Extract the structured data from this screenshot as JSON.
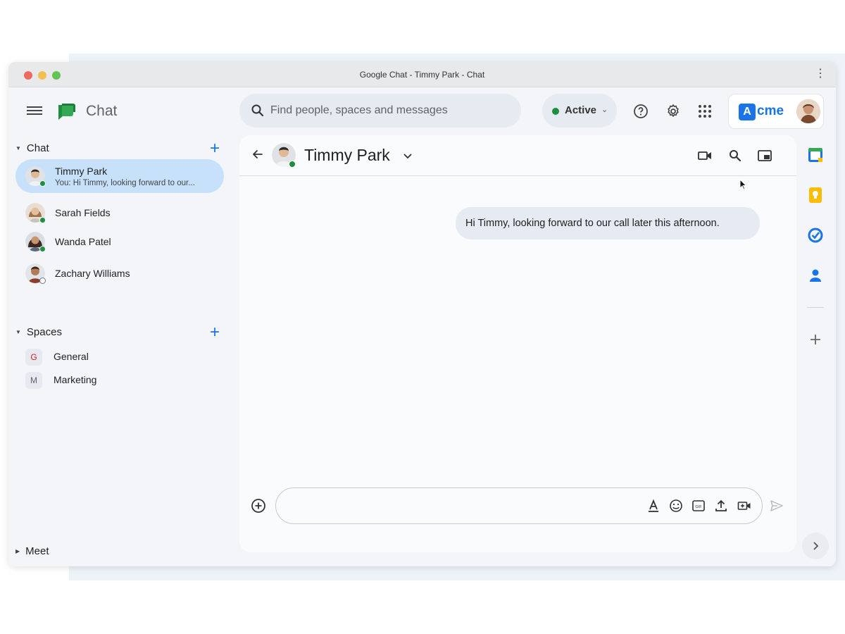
{
  "window": {
    "title": "Google Chat - Timmy Park - Chat"
  },
  "header": {
    "app_name": "Chat",
    "search_placeholder": "Find people, spaces and messages",
    "status_label": "Active",
    "brand": "cme",
    "brand_mark": "A"
  },
  "sidebar": {
    "chat_section": "Chat",
    "conversations": [
      {
        "name": "Timmy Park",
        "preview": "You: Hi Timmy, looking forward to our...",
        "presence": "active"
      },
      {
        "name": "Sarah Fields",
        "presence": "active"
      },
      {
        "name": "Wanda Patel",
        "presence": "active"
      },
      {
        "name": "Zachary Williams",
        "presence": "offline"
      }
    ],
    "spaces_section": "Spaces",
    "spaces": [
      {
        "initial": "G",
        "name": "General",
        "color": "#c5221f"
      },
      {
        "initial": "M",
        "name": "Marketing",
        "color": "#5f6368"
      }
    ],
    "meet_section": "Meet"
  },
  "conversation": {
    "title": "Timmy Park",
    "messages": [
      {
        "text": "Hi Timmy, looking forward to our call later this afternoon.",
        "from": "me"
      }
    ],
    "composer": {
      "placeholder": "",
      "tools": [
        "format-text-icon",
        "emoji-icon",
        "gif-icon",
        "upload-icon",
        "video-meeting-icon"
      ]
    }
  },
  "right_rail": [
    "calendar-icon",
    "keep-icon",
    "tasks-icon",
    "contacts-icon",
    "add-icon"
  ],
  "colors": {
    "accent": "#1a73e8",
    "active_green": "#1e8e3e",
    "selected_row": "#c7e1fb",
    "bubble": "#e6ebf3"
  }
}
